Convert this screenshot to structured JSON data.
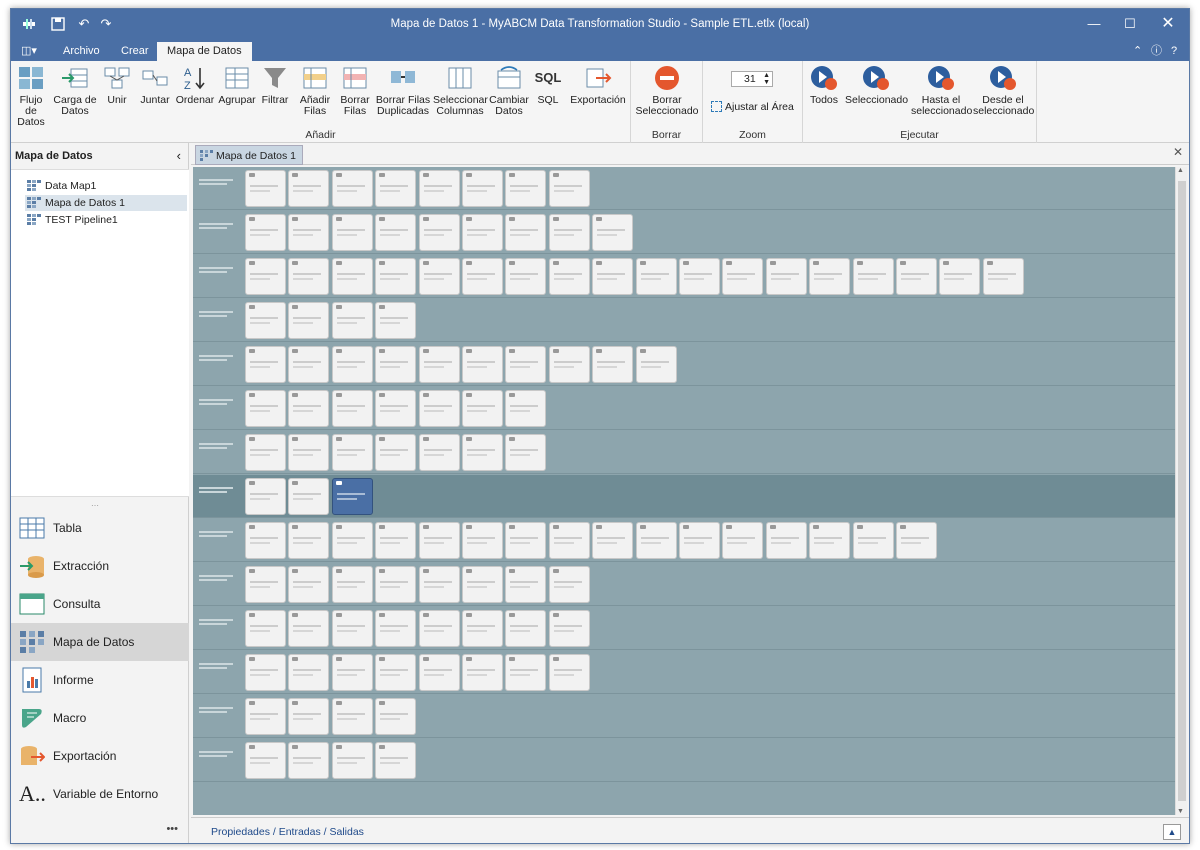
{
  "window": {
    "title": "Mapa de Datos 1 - MyABCM Data Transformation Studio - Sample ETL.etlx (local)"
  },
  "ribbon_tabs": [
    {
      "label": "Archivo"
    },
    {
      "label": "Crear"
    },
    {
      "label": "Mapa de Datos"
    }
  ],
  "ribbon": {
    "add_group": "Añadir",
    "delete_group": "Borrar",
    "zoom_group": "Zoom",
    "run_group": "Ejecutar",
    "buttons": {
      "flujo": "Flujo de Datos",
      "carga": "Carga de Datos",
      "unir": "Unir",
      "juntar": "Juntar",
      "ordenar": "Ordenar",
      "agrupar": "Agrupar",
      "filtrar": "Filtrar",
      "anadir_filas": "Añadir Filas",
      "borrar_filas": "Borrar Filas",
      "borrar_dup": "Borrar Filas Duplicadas",
      "sel_columnas": "Seleccionar Columnas",
      "cambiar_datos": "Cambiar Datos",
      "sql": "SQL",
      "exportacion": "Exportación",
      "borrar_sel": "Borrar Seleccionado",
      "zoom_value": "31",
      "ajustar": "Ajustar al Área",
      "todos": "Todos",
      "seleccionado": "Seleccionado",
      "hasta": "Hasta el seleccionado",
      "desde": "Desde el seleccionado"
    }
  },
  "left_panel": {
    "header": "Mapa de Datos",
    "tree": [
      {
        "label": "Data Map1"
      },
      {
        "label": "Mapa de Datos 1"
      },
      {
        "label": "TEST Pipeline1"
      }
    ],
    "nav": [
      {
        "label": "Tabla"
      },
      {
        "label": "Extracción"
      },
      {
        "label": "Consulta"
      },
      {
        "label": "Mapa de Datos"
      },
      {
        "label": "Informe"
      },
      {
        "label": "Macro"
      },
      {
        "label": "Exportación"
      },
      {
        "label": "Variable de Entorno"
      }
    ],
    "more": "•••"
  },
  "doc_tab": "Mapa de Datos 1",
  "canvas": {
    "lanes": [
      {
        "nodes": 8
      },
      {
        "nodes": 9
      },
      {
        "nodes": 18
      },
      {
        "nodes": 4
      },
      {
        "nodes": 10
      },
      {
        "nodes": 7
      },
      {
        "nodes": 7
      },
      {
        "nodes": 3,
        "selected_node": 3
      },
      {
        "nodes": 16
      },
      {
        "nodes": 8
      },
      {
        "nodes": 8
      },
      {
        "nodes": 8
      },
      {
        "nodes": 4
      },
      {
        "nodes": 4
      }
    ]
  },
  "bottom": {
    "link": "Propiedades / Entradas / Salidas"
  },
  "colors": {
    "titlebar": "#4a6fa5",
    "canvas": "#8da5ad",
    "selected_node": "#4a6fa5"
  }
}
